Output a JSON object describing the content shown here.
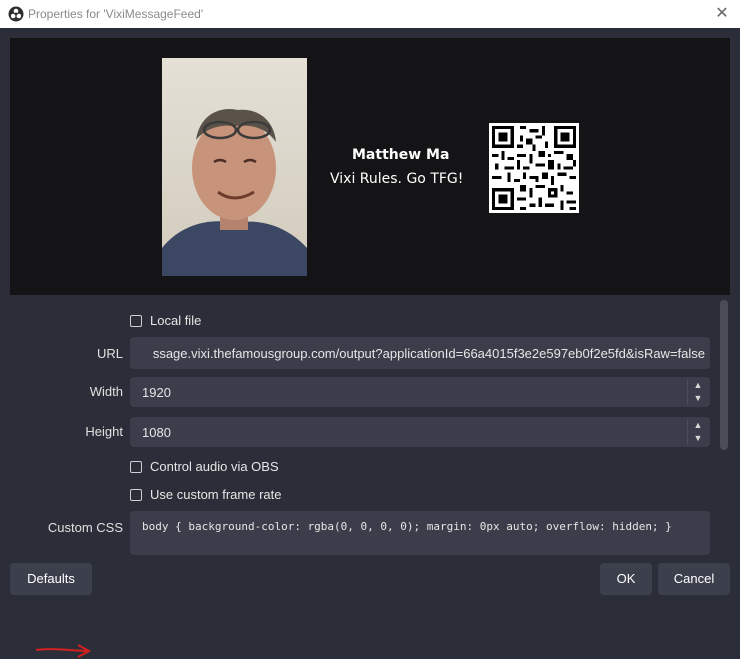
{
  "window": {
    "title": "Properties for 'VixiMessageFeed'",
    "close_glyph": "✕",
    "app_icon": "obs-logo-icon"
  },
  "preview": {
    "name": "Matthew Ma",
    "message": "Vixi Rules. Go TFG!",
    "photo_icon": "profile-photo",
    "qr_icon": "qr-code-icon"
  },
  "form": {
    "local_file_label": "Local file",
    "url_label": "URL",
    "url_value": "ssage.vixi.thefamousgroup.com/output?applicationId=66a4015f3e2e597eb0f2e5fd&isRaw=false",
    "width_label": "Width",
    "width_value": "1920",
    "height_label": "Height",
    "height_value": "1080",
    "control_audio_label": "Control audio via OBS",
    "custom_frame_label": "Use custom frame rate",
    "custom_css_label": "Custom CSS",
    "custom_css_value": "body { background-color: rgba(0, 0, 0, 0); margin: 0px auto; overflow: hidden; }",
    "spin_up": "▲",
    "spin_down": "▼"
  },
  "buttons": {
    "defaults": "Defaults",
    "ok": "OK",
    "cancel": "Cancel"
  },
  "colors": {
    "background": "#2b2e38",
    "preview_bg": "#141416",
    "field_bg": "#3b3e4a",
    "annotation_arrow": "#d42020"
  }
}
